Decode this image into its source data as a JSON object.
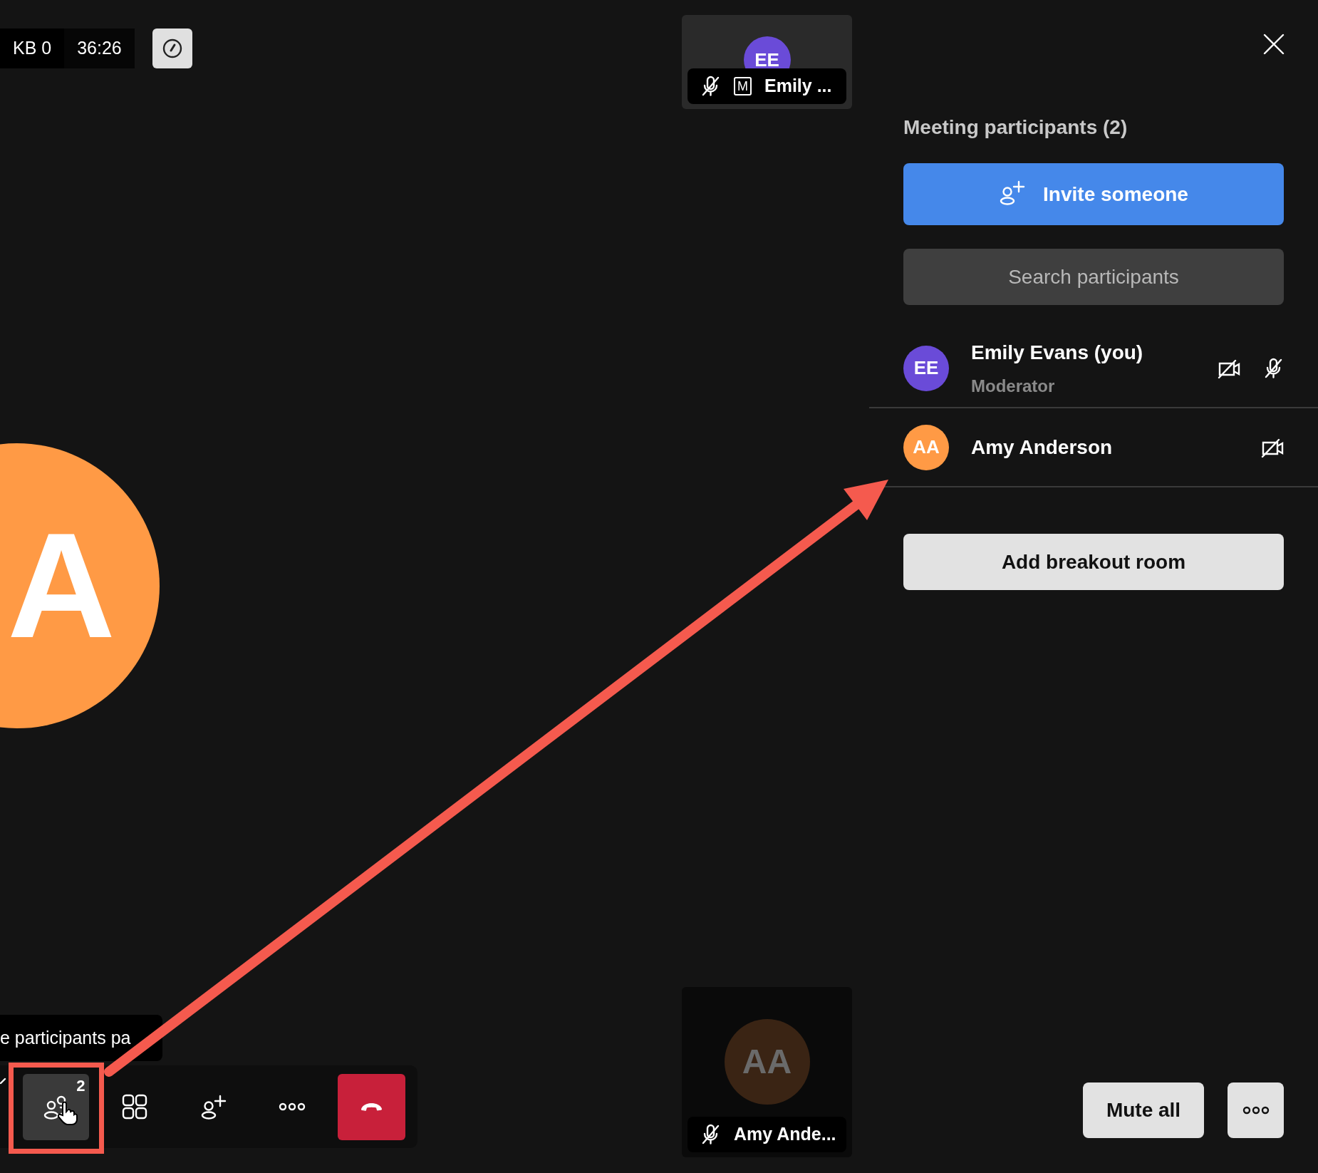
{
  "stats": {
    "data": "KB 0",
    "timer": "36:26"
  },
  "tiles": [
    {
      "initials": "EE",
      "color": "#6a4bd8",
      "name": "Emily ...",
      "muted": true,
      "role_badge": "M",
      "dimmed": false
    },
    {
      "initials": "AA",
      "color": "#3a2414",
      "name": "Amy Ande...",
      "muted": true,
      "dimmed": true
    }
  ],
  "stage_avatar": {
    "initials": "A",
    "color": "#ff9a45"
  },
  "tooltip": "e participants pa",
  "toolbar": [
    {
      "kind": "participants",
      "badge": "2",
      "selected": true
    },
    {
      "kind": "grid",
      "selected": false
    },
    {
      "kind": "invite",
      "selected": false
    },
    {
      "kind": "more",
      "selected": false
    },
    {
      "kind": "hangup",
      "selected": false
    }
  ],
  "panel": {
    "title": "Meeting participants (2)",
    "invite_button": "Invite someone",
    "search": {
      "placeholder": "Search participants"
    },
    "participants": [
      {
        "initials": "EE",
        "color": "#6a4bd8",
        "name": "Emily Evans (you)",
        "role": "Moderator",
        "camera_off": true,
        "mic_muted": true
      },
      {
        "initials": "AA",
        "color": "#ff9a45",
        "name": "Amy Anderson",
        "camera_off": true,
        "mic_muted": false
      }
    ],
    "breakout_button": "Add breakout room",
    "footer_buttons": [
      "Mute all"
    ]
  }
}
